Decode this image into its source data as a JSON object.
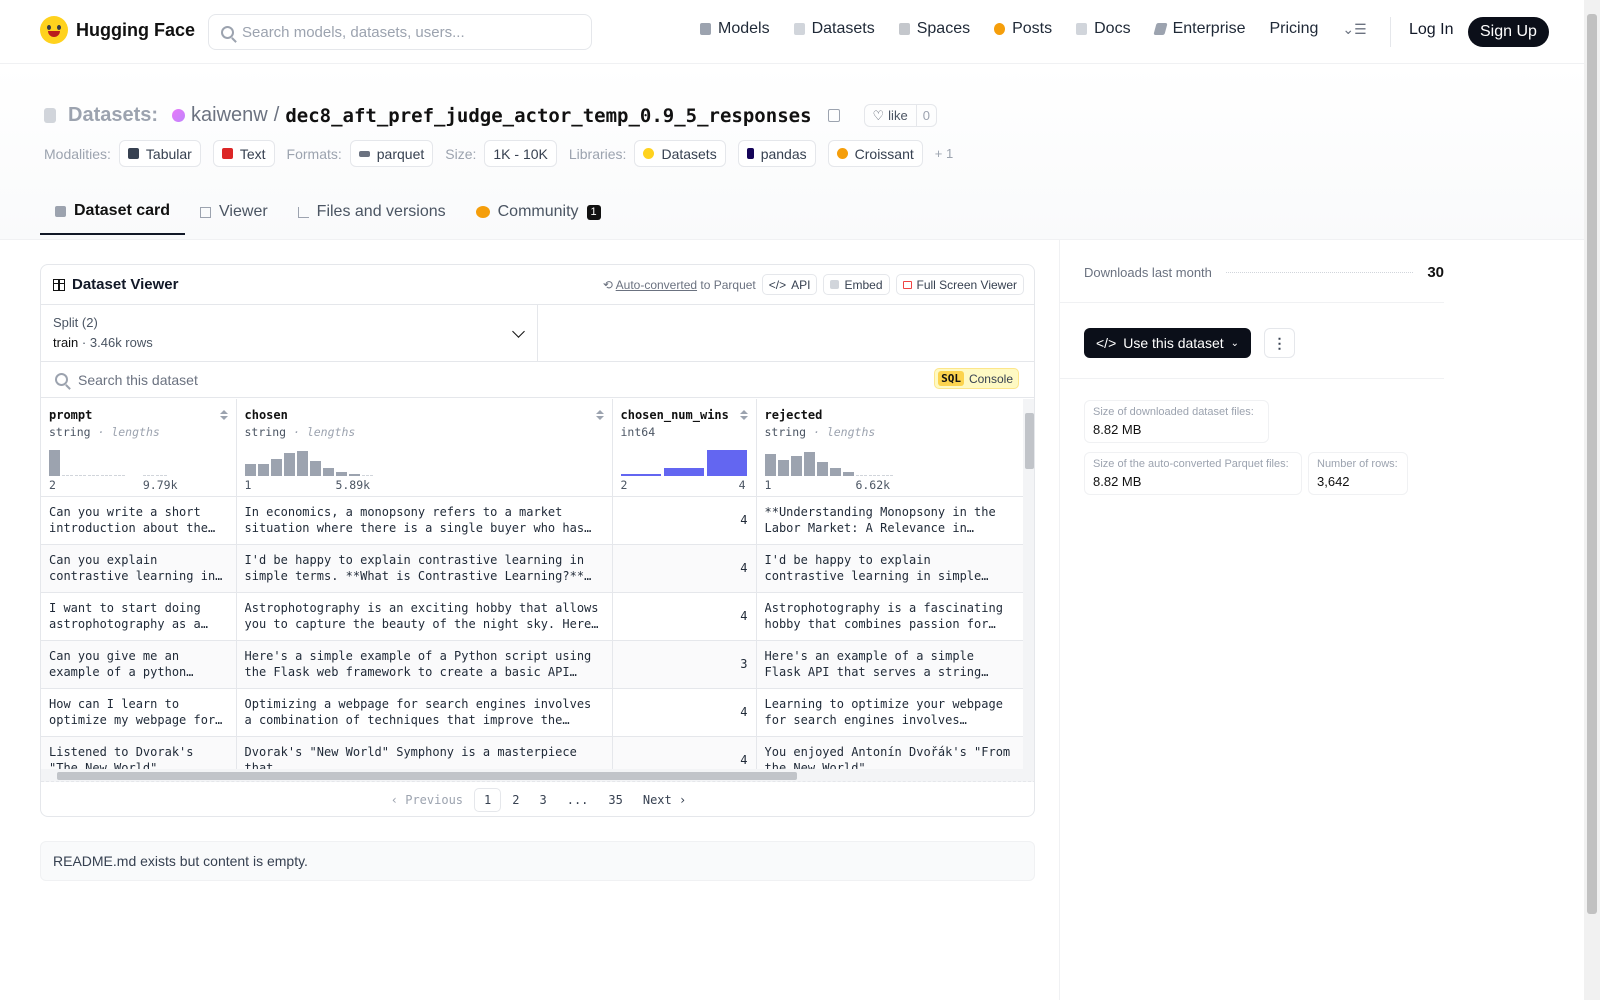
{
  "nav": {
    "brand": "Hugging Face",
    "search_placeholder": "Search models, datasets, users...",
    "links": [
      "Models",
      "Datasets",
      "Spaces",
      "Posts",
      "Docs",
      "Enterprise",
      "Pricing"
    ],
    "login": "Log In",
    "signup": "Sign Up"
  },
  "header": {
    "section": "Datasets:",
    "owner": "kaiwenw",
    "slash": "/",
    "repo": "dec8_aft_pref_judge_actor_temp_0.9_5_responses",
    "like_label": "like",
    "like_count": "0",
    "modalities_label": "Modalities:",
    "modalities": [
      "Tabular",
      "Text"
    ],
    "formats_label": "Formats:",
    "formats": [
      "parquet"
    ],
    "size_label": "Size:",
    "size": "1K - 10K",
    "libraries_label": "Libraries:",
    "libraries": [
      "Datasets",
      "pandas",
      "Croissant"
    ],
    "libraries_more": "+ 1",
    "tabs": [
      "Dataset card",
      "Viewer",
      "Files and versions",
      "Community"
    ],
    "community_badge": "1"
  },
  "viewer": {
    "title": "Dataset Viewer",
    "autoconv_link": "Auto-converted",
    "autoconv_rest": " to Parquet",
    "api": "API",
    "embed": "Embed",
    "fullscreen": "Full Screen Viewer",
    "split_label": "Split (2)",
    "split_name": "train",
    "split_sep": "·",
    "split_rows": "3.46k rows",
    "search_placeholder": "Search this dataset",
    "sql_tag": "SQL",
    "sql_label": "Console",
    "columns": [
      {
        "name": "prompt",
        "type": "string",
        "type_extra": "· lengths",
        "min": "2",
        "max": "9.79k"
      },
      {
        "name": "chosen",
        "type": "string",
        "type_extra": "· lengths",
        "min": "1",
        "max": "5.89k"
      },
      {
        "name": "chosen_num_wins",
        "type": "int64",
        "type_extra": "",
        "min": "2",
        "max": "4"
      },
      {
        "name": "rejected",
        "type": "string",
        "type_extra": "· lengths",
        "min": "1",
        "max": "6.62k"
      }
    ],
    "rows": [
      {
        "prompt": "Can you write a short introduction about the relevance of the term \"monopsony\" in economics?",
        "chosen": "In economics, a monopsony refers to a market situation where there is a single buyer who has the power to set prices.",
        "wins": "4",
        "rejected": "**Understanding Monopsony in the Labor Market: A Relevance in Modern Economics**"
      },
      {
        "prompt": "Can you explain contrastive learning in machine learning in simple terms?",
        "chosen": "I'd be happy to explain contrastive learning in simple terms. **What is Contrastive Learning?** Contrastive learning is",
        "wins": "4",
        "rejected": "I'd be happy to explain contrastive learning in simple terms. **What is Contrastive Learning?**"
      },
      {
        "prompt": "I want to start doing astrophotography as a hobby, any suggestions?",
        "chosen": "Astrophotography is an exciting hobby that allows you to capture the beauty of the night sky. Here are some suggestions",
        "wins": "4",
        "rejected": "Astrophotography is a fascinating hobby that combines passion for astronomy with photography."
      },
      {
        "prompt": "Can you give me an example of a python script that opens an api endpoint",
        "chosen": "Here's a simple example of a Python script using the Flask web framework to create a basic API endpoint that",
        "wins": "3",
        "rejected": "Here's an example of a simple Flask API that serves a string response. **app.py**"
      },
      {
        "prompt": "How can I learn to optimize my webpage for search engines?",
        "chosen": "Optimizing a webpage for search engines involves a combination of techniques that improve the page's visibility",
        "wins": "4",
        "rejected": "Learning to optimize your webpage for search engines involves understanding the key factors"
      },
      {
        "prompt": "Listened to Dvorak's \"The New World\" symphony, liked it much.",
        "chosen": "Dvorak's \"New World\" Symphony is a masterpiece that",
        "wins": "4",
        "rejected": "You enjoyed Antonín Dvořák's \"From the New World\""
      }
    ],
    "pagination": {
      "prev": "Previous",
      "pages": [
        "1",
        "2",
        "3",
        "...",
        "35"
      ],
      "next": "Next"
    }
  },
  "readme_text": "README.md exists but content is empty.",
  "sidebar": {
    "downloads_label": "Downloads last month",
    "downloads_value": "30",
    "use_button": "Use this dataset",
    "more": "⋮",
    "stats": [
      {
        "k": "Size of downloaded dataset files:",
        "v": "8.82 MB"
      },
      {
        "k": "Size of the auto-converted Parquet files:",
        "v": "8.82 MB"
      },
      {
        "k": "Number of rows:",
        "v": "3,642"
      }
    ]
  },
  "colors": {
    "accent_blue": "#6366f1",
    "dark_button": "#0b0f19",
    "brand_yellow": "#ffd21e"
  }
}
